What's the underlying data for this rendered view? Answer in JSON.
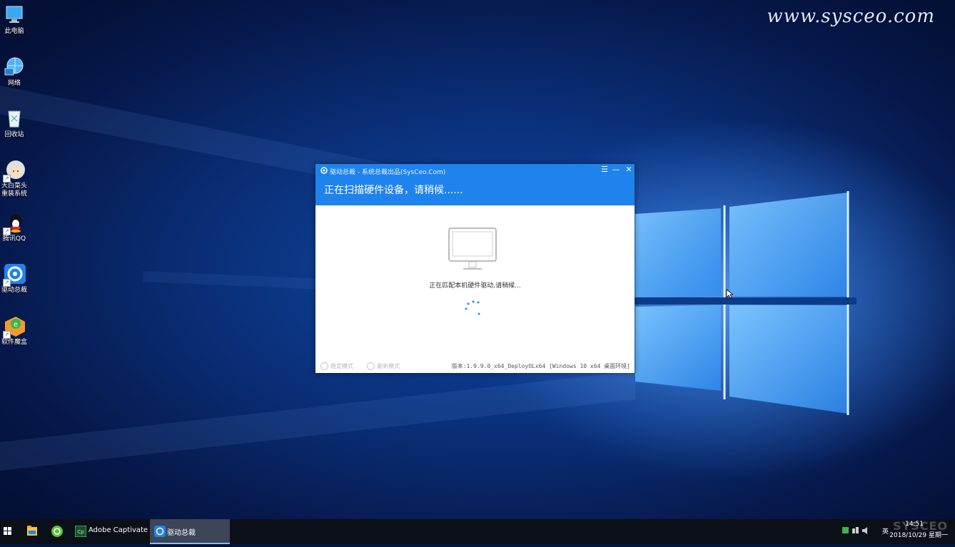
{
  "watermark": "www.sysceo.com",
  "desktop": {
    "icons": [
      {
        "label": "此电脑"
      },
      {
        "label": "网络"
      },
      {
        "label": "回收站"
      },
      {
        "label": "大白菜头重装系统"
      },
      {
        "label": "腾讯QQ"
      },
      {
        "label": "驱动总裁"
      },
      {
        "label": "软件魔盒"
      }
    ]
  },
  "app": {
    "title": "驱动总裁 - 系统总裁出品(SysCeo.Com)",
    "status": "正在扫描硬件设备，请稍候......",
    "match_text": "正在匹配本机硬件驱动,请稍候...",
    "options": {
      "stable": "稳定模式",
      "latest": "最新模式"
    },
    "version": "版本:1.9.9.0_x64_DeployOLx64 [Windows 10 x64 桌面环境]",
    "controls": {
      "menu": "☰",
      "minimize": "—",
      "close": "✕"
    }
  },
  "taskbar": {
    "captivate_label": "Adobe Captivate",
    "driver_label": "驱动总裁",
    "ime": "英",
    "time": "14:51",
    "date": "2018/10/29 星期一",
    "brand_mark": "SYSCEO"
  },
  "colors": {
    "accent": "#1f83ee",
    "taskbar": "#0b0f17"
  }
}
